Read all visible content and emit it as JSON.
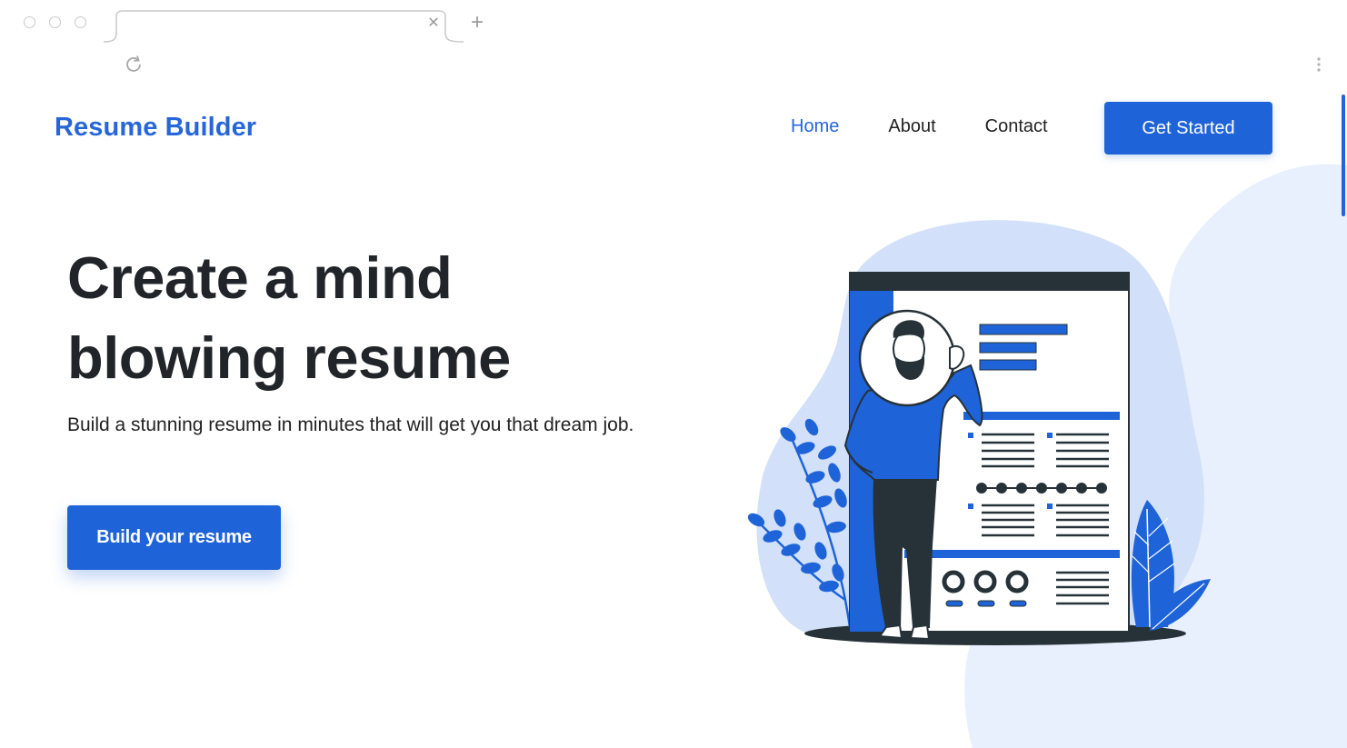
{
  "browser": {
    "tab_close_icon": "close-icon",
    "new_tab_icon": "plus-icon",
    "reload_icon": "reload-icon",
    "menu_icon": "kebab-menu-icon"
  },
  "navbar": {
    "brand": "Resume Builder",
    "links": [
      {
        "label": "Home",
        "active": true
      },
      {
        "label": "About",
        "active": false
      },
      {
        "label": "Contact",
        "active": false
      }
    ],
    "cta_label": "Get Started"
  },
  "hero": {
    "title_line1": "Create a mind",
    "title_line2": "blowing resume",
    "subtitle": "Build a stunning resume in minutes that will get you that dream job.",
    "button_label": "Build your resume"
  },
  "colors": {
    "accent": "#1e64d8",
    "brand": "#2766d9",
    "blob_light": "#e9f0fd",
    "blob_mid": "#d2e1f9",
    "dark": "#263238"
  }
}
